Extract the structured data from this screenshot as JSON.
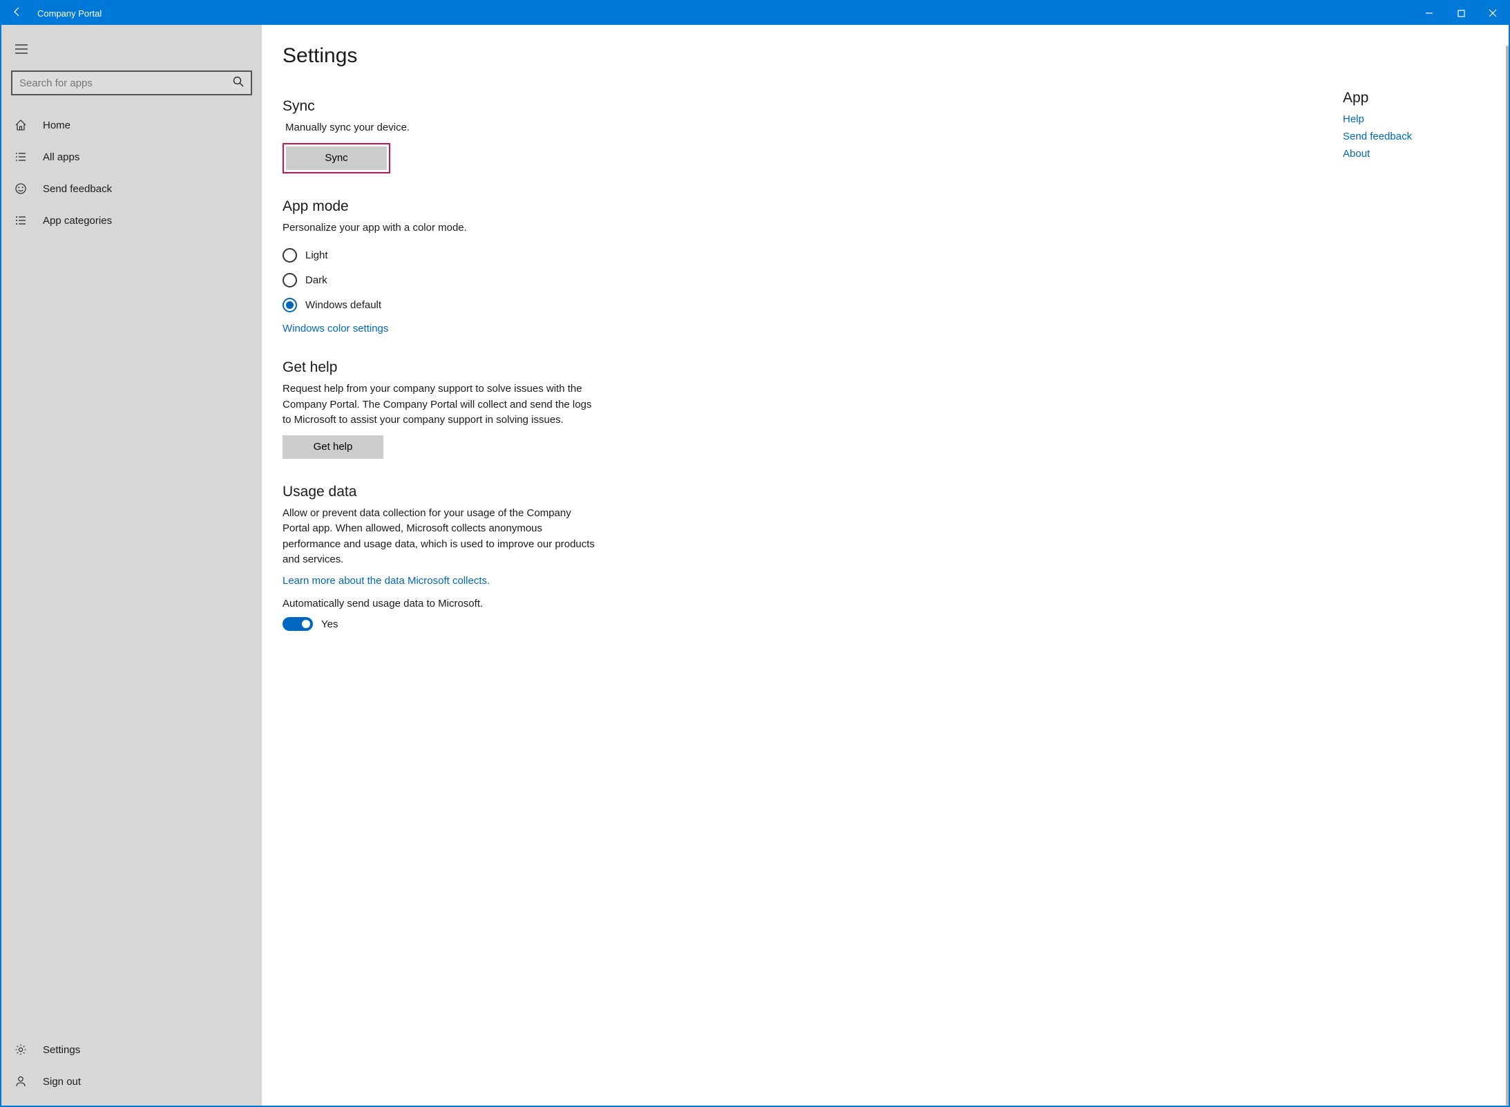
{
  "titlebar": {
    "title": "Company Portal"
  },
  "sidebar": {
    "search_placeholder": "Search for apps",
    "nav": [
      {
        "icon": "home",
        "label": "Home"
      },
      {
        "icon": "list-checked",
        "label": "All apps"
      },
      {
        "icon": "smile",
        "label": "Send feedback"
      },
      {
        "icon": "list-lines",
        "label": "App categories"
      }
    ],
    "footer": [
      {
        "icon": "gear",
        "label": "Settings"
      },
      {
        "icon": "person",
        "label": "Sign out"
      }
    ]
  },
  "content": {
    "page_title": "Settings",
    "sync": {
      "heading": "Sync",
      "desc": "Manually sync your device.",
      "button": "Sync"
    },
    "appmode": {
      "heading": "App mode",
      "desc": "Personalize your app with a color mode.",
      "options": [
        "Light",
        "Dark",
        "Windows default"
      ],
      "selected_index": 2,
      "link": "Windows color settings"
    },
    "gethelp": {
      "heading": "Get help",
      "desc": "Request help from your company support to solve issues with the Company Portal. The Company Portal will collect and send the logs to Microsoft to assist your company support in solving issues.",
      "button": "Get help"
    },
    "usage": {
      "heading": "Usage data",
      "desc": "Allow or prevent data collection for your usage of the Company Portal app. When allowed, Microsoft collects anonymous performance and usage data, which is used to improve our products and services.",
      "link": "Learn more about the data Microsoft collects.",
      "toggle_label": "Automatically send usage data to Microsoft.",
      "toggle_value": "Yes"
    }
  },
  "rightcol": {
    "heading": "App",
    "links": [
      "Help",
      "Send feedback",
      "About"
    ]
  }
}
